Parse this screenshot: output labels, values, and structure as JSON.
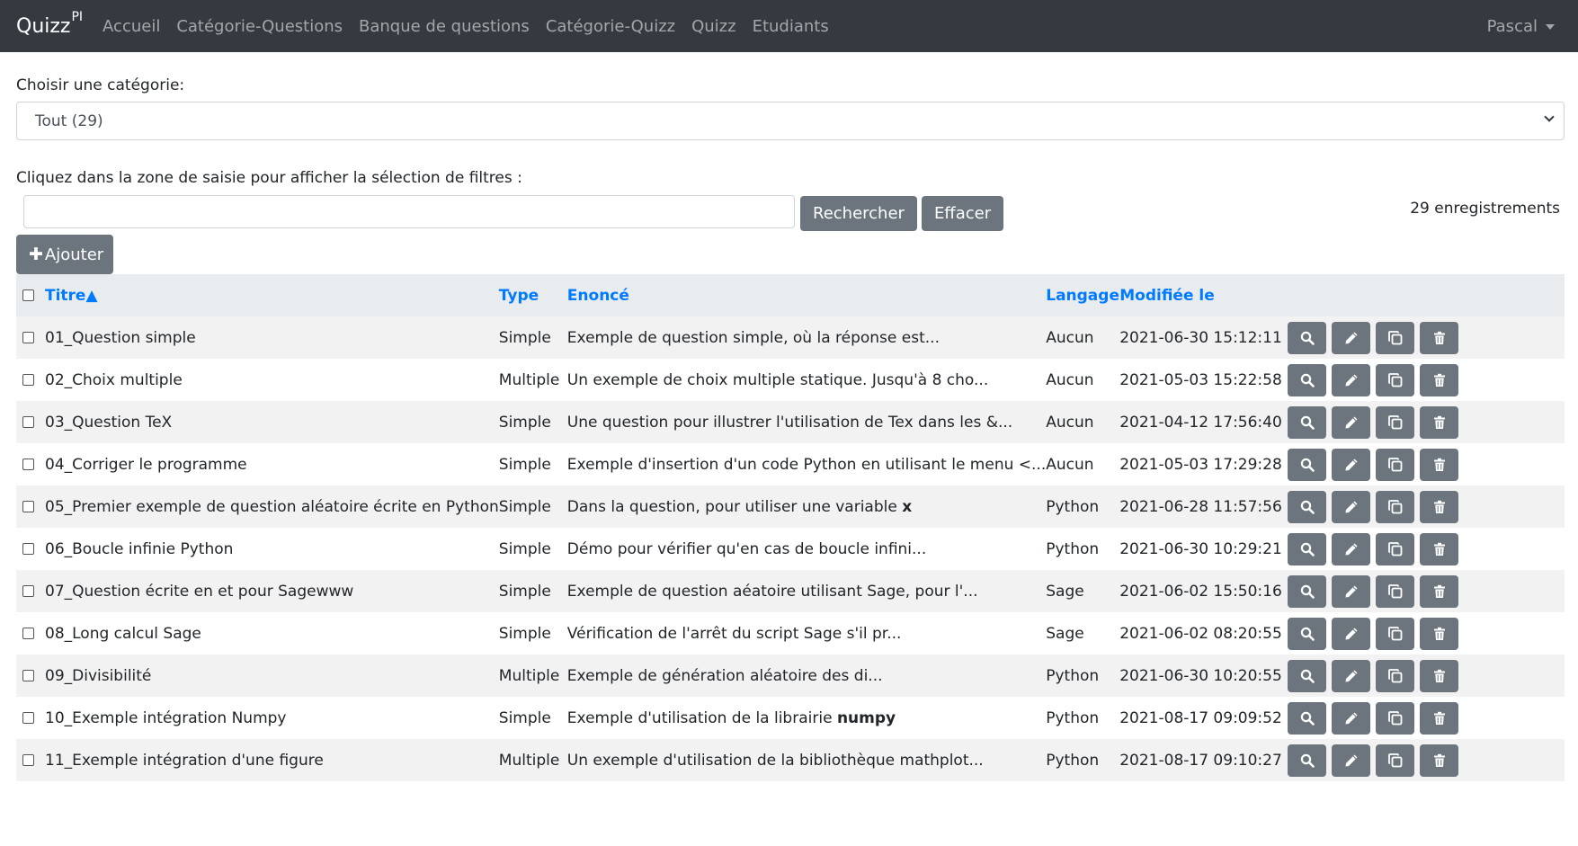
{
  "navbar": {
    "brand": "Quizz",
    "brand_sup": "PI",
    "items": [
      "Accueil",
      "Catégorie-Questions",
      "Banque de questions",
      "Catégorie-Quizz",
      "Quizz",
      "Etudiants"
    ],
    "user": "Pascal"
  },
  "category": {
    "label": "Choisir une catégorie:",
    "selected": "Tout (29)"
  },
  "filter": {
    "label": "Cliquez dans la zone de saisie pour afficher la sélection de filtres :",
    "input_value": "",
    "search_label": "Rechercher",
    "clear_label": "Effacer",
    "count": "29 enregistrements"
  },
  "add_button": "Ajouter",
  "table": {
    "headers": {
      "title": "Titre▲",
      "type": "Type",
      "enonce": "Enoncé",
      "lang": "Langage",
      "modified": "Modifiée le"
    },
    "rows": [
      {
        "title": "01_Question simple",
        "type": "Simple",
        "enonce": "Exemple de question simple, où la réponse est...",
        "enonce_bold": "",
        "lang": "Aucun",
        "modified": "2021-06-30 15:12:11"
      },
      {
        "title": "02_Choix multiple",
        "type": "Multiple",
        "enonce": "Un exemple de choix multiple statique. Jusqu'à 8 cho...",
        "enonce_bold": "",
        "lang": "Aucun",
        "modified": "2021-05-03 15:22:58"
      },
      {
        "title": "03_Question TeX",
        "type": "Simple",
        "enonce": "Une question pour illustrer l'utilisation de Tex dans les &...",
        "enonce_bold": "",
        "lang": "Aucun",
        "modified": "2021-04-12 17:56:40"
      },
      {
        "title": "04_Corriger le programme",
        "type": "Simple",
        "enonce": "Exemple d'insertion d'un code Python en utilisant le menu <...",
        "enonce_bold": "",
        "lang": "Aucun",
        "modified": "2021-05-03 17:29:28"
      },
      {
        "title": "05_Premier exemple de question aléatoire écrite en Python",
        "type": "Simple",
        "enonce": "Dans la question, pour utiliser une variable ",
        "enonce_bold": "x",
        "lang": "Python",
        "modified": "2021-06-28 11:57:56"
      },
      {
        "title": "06_Boucle infinie Python",
        "type": "Simple",
        "enonce": "Démo pour vérifier qu'en cas de boucle infini...",
        "enonce_bold": "",
        "lang": "Python",
        "modified": "2021-06-30 10:29:21"
      },
      {
        "title": "07_Question écrite en et pour Sagewww",
        "type": "Simple",
        "enonce": "Exemple de question aéatoire utilisant Sage, pour l'...",
        "enonce_bold": "",
        "lang": "Sage",
        "modified": "2021-06-02 15:50:16"
      },
      {
        "title": "08_Long calcul Sage",
        "type": "Simple",
        "enonce": "Vérification de l'arrêt du script Sage s'il pr...",
        "enonce_bold": "",
        "lang": "Sage",
        "modified": "2021-06-02 08:20:55"
      },
      {
        "title": "09_Divisibilité",
        "type": "Multiple",
        "enonce": "Exemple de génération aléatoire des di...",
        "enonce_bold": "",
        "lang": "Python",
        "modified": "2021-06-30 10:20:55"
      },
      {
        "title": "10_Exemple intégration Numpy",
        "type": "Simple",
        "enonce": "Exemple d'utilisation de la librairie ",
        "enonce_bold": "numpy",
        "lang": "Python",
        "modified": "2021-08-17 09:09:52"
      },
      {
        "title": "11_Exemple intégration d'une figure",
        "type": "Multiple",
        "enonce": "Un exemple d'utilisation de la bibliothèque mathplot...",
        "enonce_bold": "",
        "lang": "Python",
        "modified": "2021-08-17 09:10:27"
      }
    ]
  },
  "icons": {
    "view": "search-icon",
    "edit": "pencil-icon",
    "copy": "copy-icon",
    "delete": "trash-icon"
  }
}
